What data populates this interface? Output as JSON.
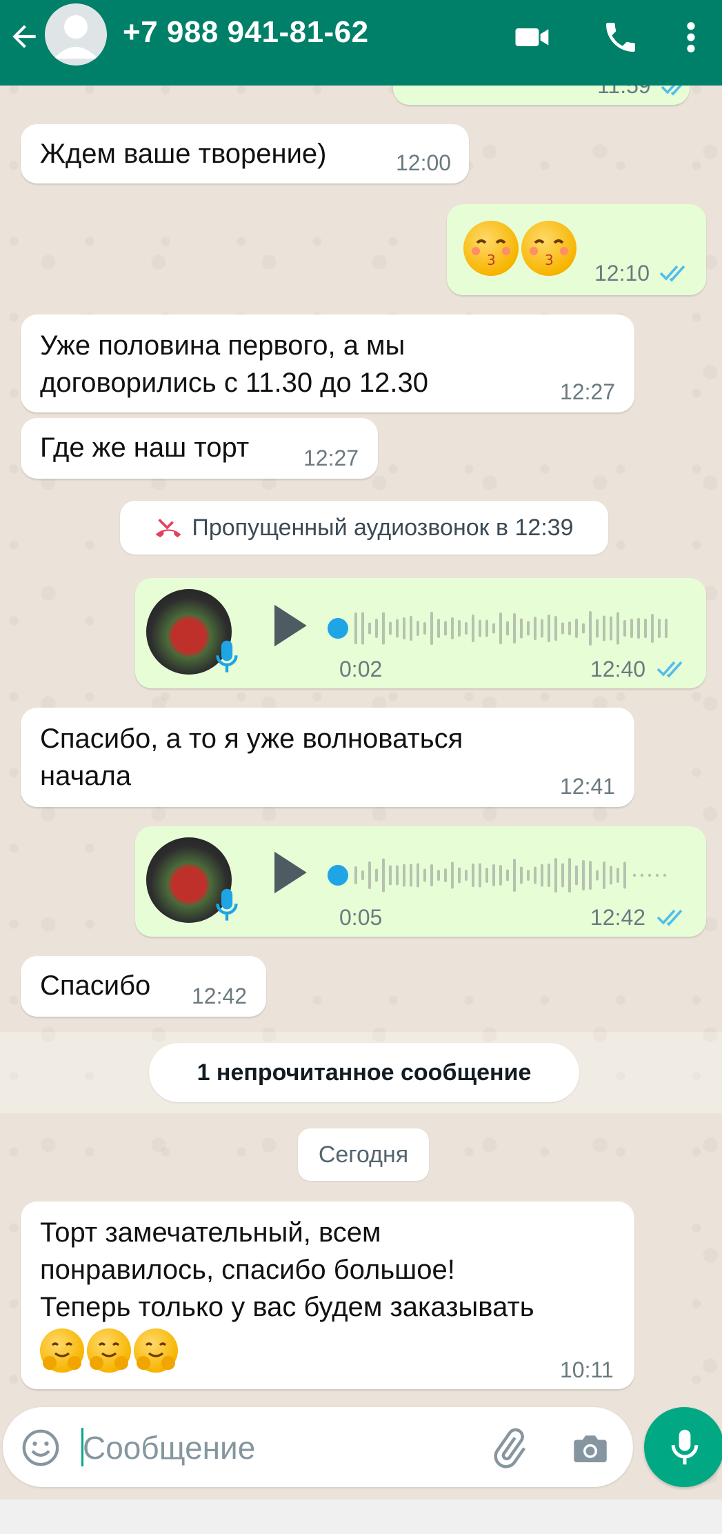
{
  "header": {
    "contact": "+7 988 941-81-62",
    "color": "#008069"
  },
  "messages": [
    {
      "id": "m0",
      "dir": "out",
      "time": "11:59",
      "partial": true
    },
    {
      "id": "m1",
      "dir": "in",
      "text": "Ждем ваше творение)",
      "time": "12:00"
    },
    {
      "id": "m2",
      "dir": "out",
      "emoji": [
        "kissing-face-with-closed-eyes",
        "kissing-face-with-closed-eyes"
      ],
      "time": "12:10"
    },
    {
      "id": "m3",
      "dir": "in",
      "text": "Уже половина первого, а мы\nдоговорились с 11.30 до 12.30",
      "time": "12:27"
    },
    {
      "id": "m4",
      "dir": "in",
      "text": "Где же наш торт",
      "time": "12:27"
    },
    {
      "id": "m6",
      "dir": "out",
      "type": "voice",
      "duration": "0:02",
      "time": "12:40"
    },
    {
      "id": "m7",
      "dir": "in",
      "text": "Спасибо, а то я уже волноваться\nначала",
      "time": "12:41"
    },
    {
      "id": "m8",
      "dir": "out",
      "type": "voice",
      "duration": "0:05",
      "time": "12:42"
    },
    {
      "id": "m9",
      "dir": "in",
      "text": "Спасибо",
      "time": "12:42"
    },
    {
      "id": "m10",
      "dir": "in",
      "text": "Торт замечательный, всем\nпонравилось, спасибо большое!\nТеперь только у вас будем заказывать",
      "emoji": [
        "smiling-face-with-open-hands",
        "smiling-face-with-open-hands",
        "smiling-face-with-open-hands"
      ],
      "time": "10:11"
    }
  ],
  "missed_call": "Пропущенный аудиозвонок в 12:39",
  "unread_label": "1 непрочитанное сообщение",
  "date_label": "Сегодня",
  "input": {
    "placeholder": "Сообщение"
  },
  "icons": [
    "back-arrow-icon",
    "video-call-icon",
    "phone-icon",
    "more-vert-icon",
    "missed-call-icon",
    "play-icon",
    "mic-badge-icon",
    "double-check-icon",
    "emoji-icon",
    "attach-icon",
    "camera-icon",
    "mic-icon"
  ],
  "colors": {
    "incoming_bubble": "#ffffff",
    "outgoing_bubble": "#e7fdd6",
    "read_ticks": "#53bdeb",
    "accent": "#00a884",
    "missed_call": "#e5405e"
  }
}
